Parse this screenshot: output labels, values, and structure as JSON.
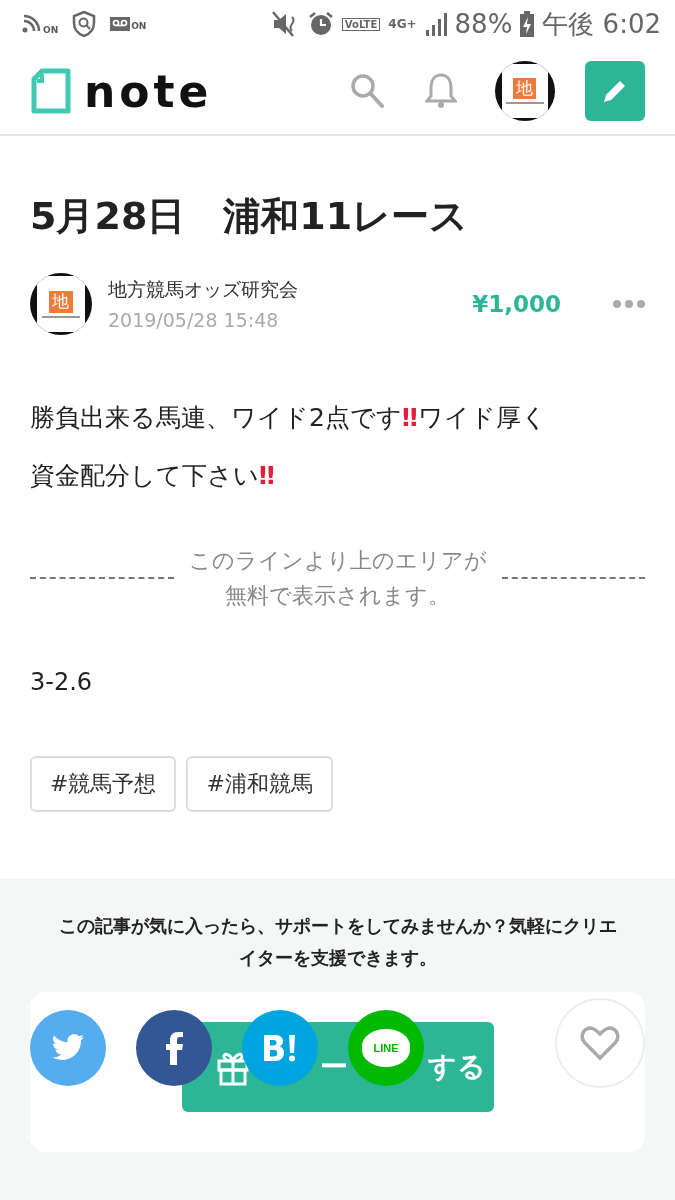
{
  "status_bar": {
    "left_icons": [
      {
        "kind": "nfc",
        "badge": "ON"
      },
      {
        "kind": "shield"
      },
      {
        "kind": "voicemail",
        "badge": "ON"
      }
    ],
    "volte": "VoLTE",
    "network": "4G+",
    "battery": "88%",
    "time": "午後 6:02"
  },
  "header": {
    "logo": "note",
    "avatar": {
      "glyph": "地"
    }
  },
  "article": {
    "title": "5月28日　浦和11レース",
    "author": {
      "name": "地方競馬オッズ研究会",
      "date": "2019/05/28 15:48",
      "avatar": {
        "glyph": "地"
      }
    },
    "price": "¥1,000",
    "body": [
      {
        "kind": "plain",
        "text": "勝負出来る馬連、ワイド2点です"
      },
      {
        "kind": "emoji",
        "text": "‼"
      },
      {
        "kind": "plain",
        "text": "ワイド厚く資金配分して下さい"
      },
      {
        "kind": "emoji",
        "text": "‼"
      }
    ],
    "paywall_note": "このラインより上のエリアが無料で表示されます。",
    "paid_text": "3-2.6",
    "tags": [
      "#競馬予想",
      "#浦和競馬"
    ]
  },
  "support": {
    "message": "この記事が気に入ったら、サポートをしてみませんか？気軽にクリエイターを支援できます。",
    "button_parts": [
      "ー",
      "する"
    ],
    "share": [
      {
        "kind": "twitter",
        "color": "#55acee"
      },
      {
        "kind": "facebook",
        "color": "#335795"
      },
      {
        "kind": "hatena",
        "color": "#00a4de"
      },
      {
        "kind": "line",
        "glyph": "LINE",
        "color": "#00b900"
      }
    ],
    "liked": false
  }
}
